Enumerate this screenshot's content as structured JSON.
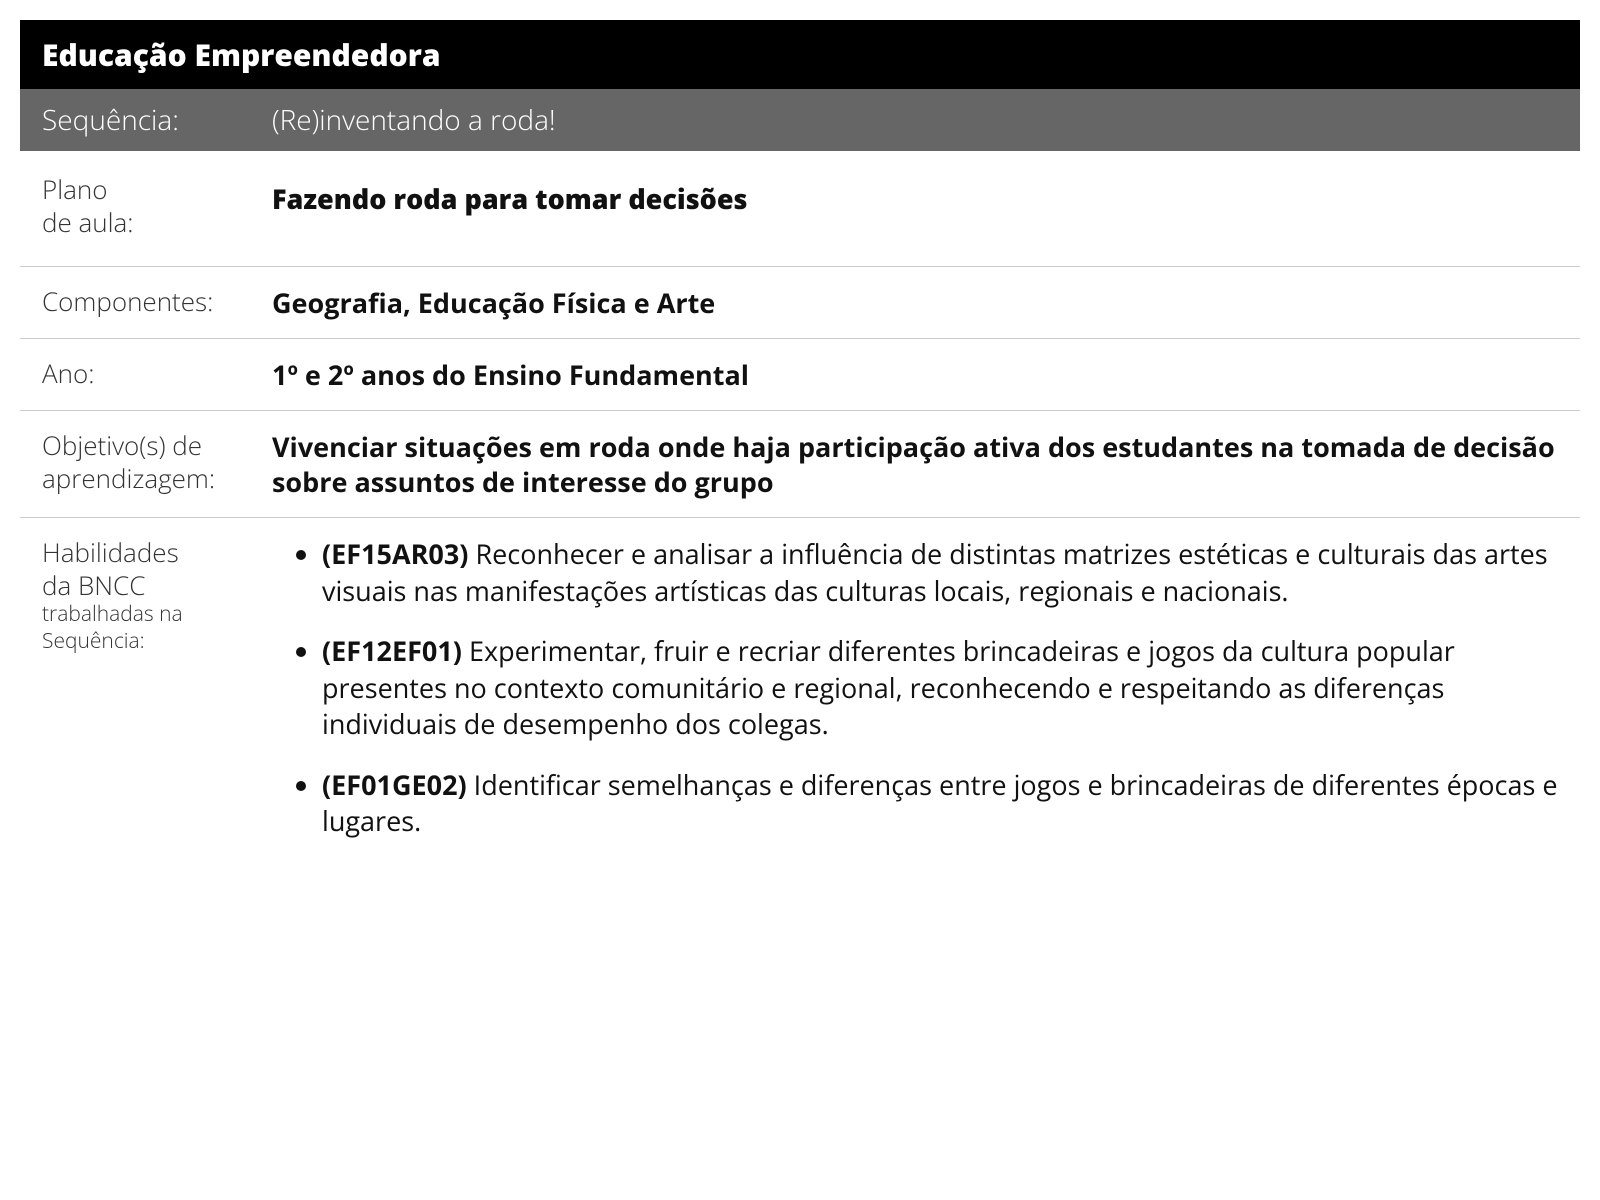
{
  "header": {
    "title": "Educação Empreendedora"
  },
  "sequence": {
    "label": "Sequência:",
    "value": "(Re)inventando a roda!"
  },
  "plan": {
    "label_line1": "Plano",
    "label_line2": "de aula:",
    "title": "Fazendo roda para tomar decisões"
  },
  "components": {
    "label": "Componentes:",
    "value": "Geografia, Educação Física e Arte"
  },
  "year": {
    "label": "Ano:",
    "value": "1º e 2º anos do Ensino Fundamental"
  },
  "objectives": {
    "label_line1": "Objetivo(s) de",
    "label_line2": "aprendizagem:",
    "value": "Vivenciar situações em roda onde haja participação ativa dos estudantes na tomada de decisão sobre assuntos de interesse do grupo"
  },
  "skills": {
    "label_line1": "Habilidades",
    "label_line2": "da BNCC",
    "label_line3": "trabalhadas na",
    "label_line4": "Sequência:",
    "items": [
      {
        "code": "(EF15AR03)",
        "text": " Reconhecer e analisar a influência de distintas matrizes estéticas e culturais das artes visuais nas manifestações artísticas das culturas locais, regionais e nacionais."
      },
      {
        "code": "(EF12EF01)",
        "text": " Experimentar, fruir e recriar diferentes brincadeiras e jogos da cultura popular presentes no contexto comunitário e regional, reconhecendo e respeitando as diferenças individuais de desempenho dos colegas."
      },
      {
        "code": "(EF01GE02)",
        "text": " Identificar semelhanças e diferenças entre jogos e brincadeiras de diferentes épocas e lugares."
      }
    ]
  }
}
